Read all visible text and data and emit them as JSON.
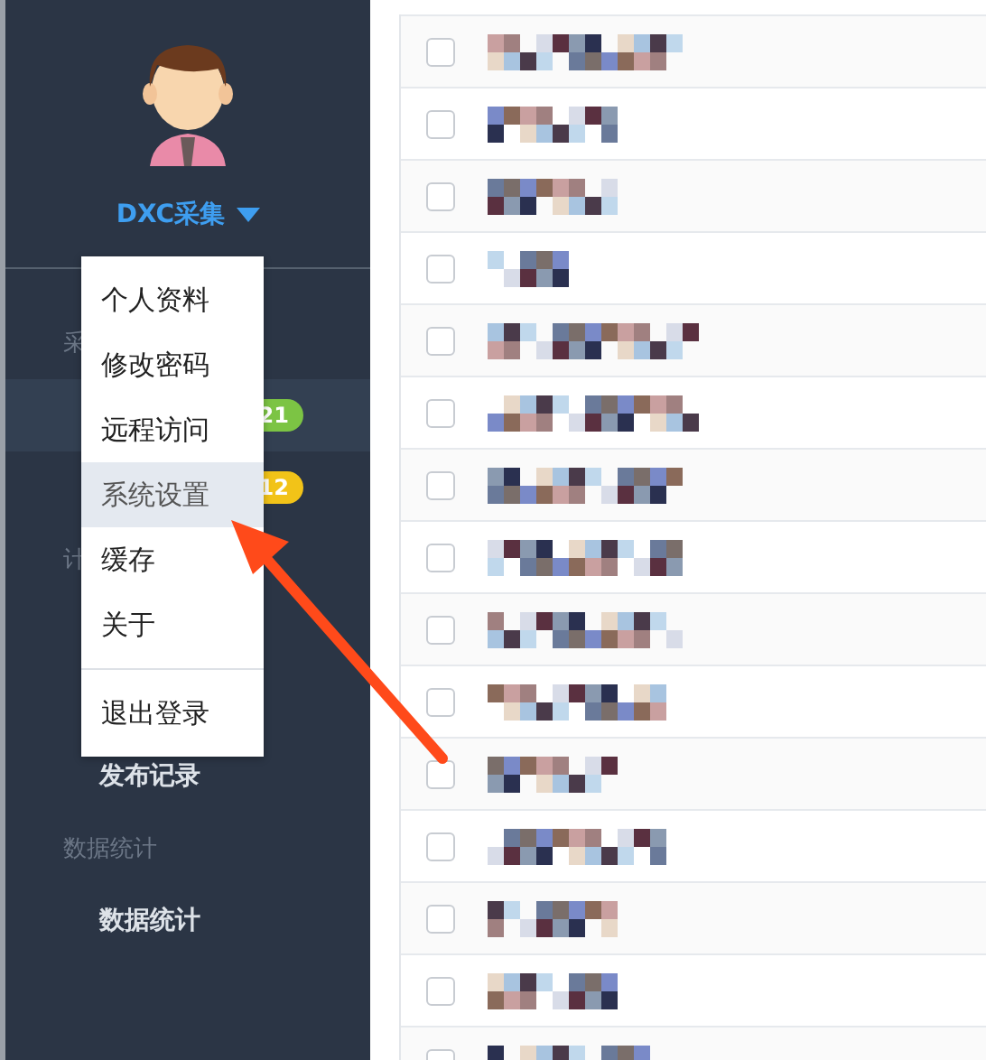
{
  "user": {
    "name": "DXC采集"
  },
  "sidebar": {
    "sections": [
      {
        "label": "采",
        "items": [
          {
            "badge": "21",
            "color": "#7cc444",
            "selected": true
          },
          {
            "badge": "12",
            "color": "#f2c318",
            "selected": false
          }
        ]
      },
      {
        "label": "计",
        "items": [
          {
            "selected": false
          },
          {
            "selected": false
          },
          {
            "label": "发布记录",
            "selected": false
          }
        ]
      },
      {
        "label": "数据统计",
        "items": [
          {
            "label": "数据统计",
            "selected": false
          }
        ]
      }
    ]
  },
  "user_menu": {
    "items": [
      {
        "label": "个人资料",
        "selected": false
      },
      {
        "label": "修改密码",
        "selected": false
      },
      {
        "label": "远程访问",
        "selected": false
      },
      {
        "label": "系统设置",
        "selected": true
      },
      {
        "label": "缓存",
        "selected": false
      },
      {
        "label": "关于",
        "selected": false
      },
      {
        "label": "退出登录",
        "selected": false,
        "divider_before": true
      }
    ]
  },
  "table": {
    "rows": [
      {
        "checked": false
      },
      {
        "checked": false
      },
      {
        "checked": false
      },
      {
        "checked": false
      },
      {
        "checked": false
      },
      {
        "checked": false
      },
      {
        "checked": false
      },
      {
        "checked": false
      },
      {
        "checked": false
      },
      {
        "checked": false
      },
      {
        "checked": false
      },
      {
        "checked": false
      },
      {
        "checked": false
      },
      {
        "checked": false
      },
      {
        "checked": false
      }
    ]
  }
}
